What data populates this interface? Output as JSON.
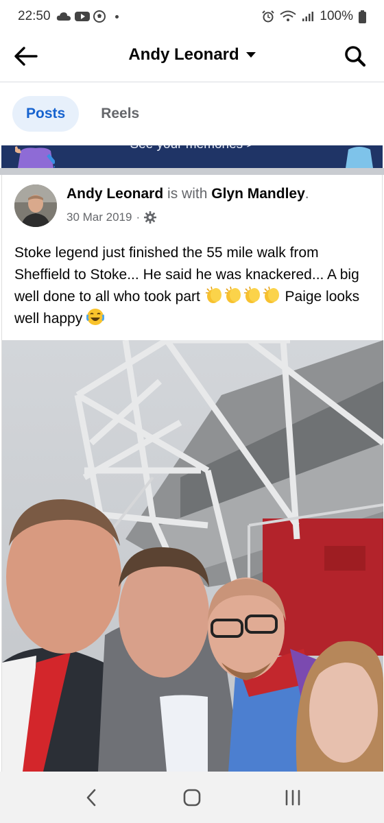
{
  "status_bar": {
    "time": "22:50",
    "battery": "100%",
    "icons": [
      "cloud-icon",
      "youtube-icon",
      "football-icon",
      "alarm-icon",
      "wifi-icon",
      "signal-icon",
      "battery-icon"
    ]
  },
  "header": {
    "title": "Andy Leonard",
    "back_icon": "back-arrow-icon",
    "search_icon": "search-icon"
  },
  "tabs": [
    {
      "label": "Posts",
      "active": true
    },
    {
      "label": "Reels",
      "active": false
    }
  ],
  "memories_banner": {
    "text": "See your memories >"
  },
  "post": {
    "author": "Andy Leonard",
    "with_text": "is with",
    "tagged": "Glyn Mandley",
    "period": ".",
    "date": "30 Mar 2019",
    "separator": "·",
    "privacy_icon": "gear-icon",
    "text_main": "Stoke legend just finished the 55 mile walk from Sheffield to Stoke... He said he was knackered... A big well done to all who took part",
    "text_tail": "Paige looks well happy"
  },
  "colors": {
    "accent": "#1763cf",
    "tab_active_bg": "#e7f0fb",
    "banner_bg": "#1f3466",
    "muted": "#65676b"
  },
  "navbar": {
    "icons": [
      "back-nav-icon",
      "home-nav-icon",
      "recents-nav-icon"
    ]
  }
}
